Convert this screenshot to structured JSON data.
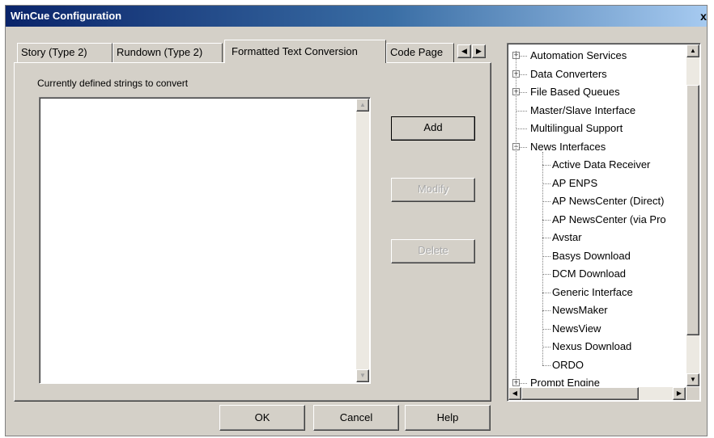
{
  "window": {
    "title": "WinCue Configuration",
    "close_label": "x"
  },
  "tabs": [
    {
      "label": "Story (Type 2)"
    },
    {
      "label": "Rundown (Type 2)"
    },
    {
      "label": "Formatted Text Conversion",
      "active": true
    },
    {
      "label": "Code Page"
    }
  ],
  "panel": {
    "list_label": "Currently defined strings to convert",
    "add_label": "Add",
    "modify_label": "Modify",
    "delete_label": "Delete"
  },
  "footer": {
    "ok_label": "OK",
    "cancel_label": "Cancel",
    "help_label": "Help"
  },
  "tree": {
    "items": [
      {
        "label": "Automation Services",
        "level": 0,
        "expander": "+"
      },
      {
        "label": "Data Converters",
        "level": 0,
        "expander": "+"
      },
      {
        "label": "File Based Queues",
        "level": 0,
        "expander": "+"
      },
      {
        "label": "Master/Slave Interface",
        "level": 0,
        "expander": ""
      },
      {
        "label": "Multilingual Support",
        "level": 0,
        "expander": ""
      },
      {
        "label": "News Interfaces",
        "level": 0,
        "expander": "-"
      },
      {
        "label": "Active Data Receiver",
        "level": 1
      },
      {
        "label": "AP ENPS",
        "level": 1
      },
      {
        "label": "AP NewsCenter (Direct)",
        "level": 1
      },
      {
        "label": "AP NewsCenter (via Pro",
        "level": 1
      },
      {
        "label": "Avstar",
        "level": 1
      },
      {
        "label": "Basys Download",
        "level": 1
      },
      {
        "label": "DCM Download",
        "level": 1
      },
      {
        "label": "Generic Interface",
        "level": 1
      },
      {
        "label": "NewsMaker",
        "level": 1
      },
      {
        "label": "NewsView",
        "level": 1
      },
      {
        "label": "Nexus Download",
        "level": 1
      },
      {
        "label": "ORDO",
        "level": 1
      },
      {
        "label": "Prompt Engine",
        "level": 0,
        "expander": "+"
      }
    ]
  },
  "colors": {
    "face": "#d4d0c8",
    "title_start": "#0a246a",
    "title_end": "#a6caf0"
  }
}
